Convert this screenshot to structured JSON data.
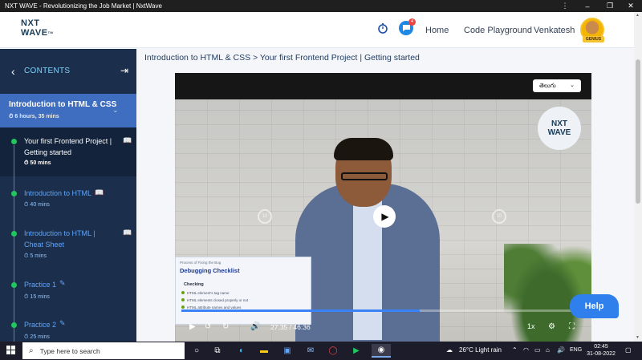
{
  "window": {
    "title": "NXT WAVE - Revolutionizing the Job Market | NxtWave",
    "controls": [
      "⋮",
      "–",
      "❐",
      "✕"
    ]
  },
  "header": {
    "logo_line1": "NXT",
    "logo_line2": "WAVE",
    "logo_tm": "TM",
    "notification_count": "4",
    "nav": [
      "Home",
      "Code Playground"
    ],
    "user_name": "Venkatesh",
    "user_badge": "GENIUS"
  },
  "sidebar": {
    "header_label": "CONTENTS",
    "module": {
      "name": "Introduction to HTML & CSS",
      "duration": "6 hours, 35 mins"
    },
    "lessons": [
      {
        "title": "Your first Frontend Project | Getting started",
        "duration": "50 mins",
        "active": true,
        "type": "reading"
      },
      {
        "title": "Introduction to HTML",
        "duration": "40 mins",
        "active": false,
        "type": "reading"
      },
      {
        "title": "Introduction to HTML | Cheat Sheet",
        "duration": "5 mins",
        "active": false,
        "type": "reading"
      },
      {
        "title": "Practice 1",
        "duration": "15 mins",
        "active": false,
        "type": "practice"
      },
      {
        "title": "Practice 2",
        "duration": "25 mins",
        "active": false,
        "type": "practice"
      }
    ]
  },
  "breadcrumb": "Introduction to HTML & CSS > Your first Frontend Project | Getting started",
  "video": {
    "language": "తెలుగు",
    "logo_line1": "NXT",
    "logo_line2": "WAVE",
    "skip_back": "10",
    "skip_forward": "10",
    "slide": {
      "caption": "Process of Fixing the Bug",
      "title": "Debugging Checklist",
      "subtitle": "Checking",
      "items": [
        "HTML element's tag name",
        "HTML elements closed properly or not",
        "HTML attribute names and values"
      ]
    },
    "progress": 0.59,
    "current_time": "27:35",
    "separator": "/",
    "total_time": "46:36",
    "speed": "1x"
  },
  "help_button": "Help",
  "taskbar": {
    "search_placeholder": "Type here to search",
    "weather": "26°C  Light rain",
    "language": "ENG",
    "time": "02:45",
    "date": "31-08-2022"
  },
  "colors": {
    "sidebar_bg": "#1b2e4b",
    "module_bg": "#3f6ec0",
    "accent": "#2f80ed",
    "complete": "#22c55e"
  }
}
